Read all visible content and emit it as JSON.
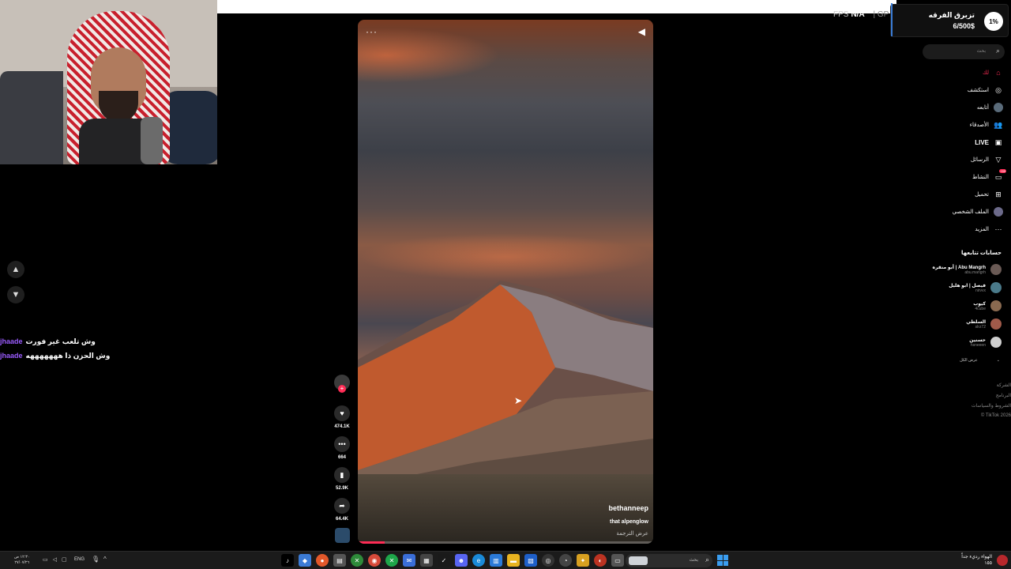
{
  "overlay": {
    "fps_label": "FPS",
    "fps_value": "N/A",
    "gpu_partial": "| GP"
  },
  "goal": {
    "title": "تزبرق الفرقه",
    "amount": "6/500$",
    "percent": "1%"
  },
  "chat": [
    {
      "user": "jhaade",
      "message": "وش تلعب غير فورت"
    },
    {
      "user": "jhaade",
      "message": "وش الحزن ذا هههههههه"
    }
  ],
  "video": {
    "author": "bethanneep",
    "caption": "that alpenglow",
    "translate": "عرض الترجمة",
    "progress": 0.09,
    "menu_icon": "more-icon",
    "volume_icon": "volume-icon"
  },
  "actions": {
    "likes": "474.1K",
    "comments": "664",
    "saves": "52.9K",
    "shares": "64.4K"
  },
  "sidebar": {
    "search_placeholder": "بحث",
    "nav": [
      {
        "label": "لك",
        "icon": "home-icon"
      },
      {
        "label": "استكشف",
        "icon": "compass-icon"
      },
      {
        "label": "أتابعه",
        "icon": "following-avatar-icon"
      },
      {
        "label": "الأصدقاء",
        "icon": "friends-icon"
      },
      {
        "label": "LIVE",
        "icon": "live-icon"
      },
      {
        "label": "الرسائل",
        "icon": "messages-icon"
      },
      {
        "label": "النشاط",
        "icon": "activity-icon",
        "badge": "99+"
      },
      {
        "label": "تحميل",
        "icon": "upload-icon"
      },
      {
        "label": "الملف الشخصي",
        "icon": "profile-icon"
      },
      {
        "label": "المزيد",
        "icon": "more-dots-icon"
      }
    ],
    "following_title": "حسابات تتابعها",
    "accounts": [
      {
        "name": "Abu Mangrh | أبو منقره",
        "handle": "abu.mangrh"
      },
      {
        "name": "فيصل | ابو هليل",
        "handle": "nirvvx"
      },
      {
        "name": "كيوب",
        "handle": "4cube"
      },
      {
        "name": "السلطي",
        "handle": "slrz72"
      },
      {
        "name": "حسنين",
        "handle": "hsneeen"
      }
    ],
    "see_all": "عرض الكل",
    "footer": [
      "الشركة",
      "البرنامج",
      "الشروط والسياسات",
      "© TikTok 2026"
    ]
  },
  "taskbar": {
    "time": "١٢:٣٠ ص",
    "date": "٢٧/٠٧/٢٦",
    "lang": "ENG",
    "search_placeholder": "بحث",
    "news_title": "الهواء رديء جداً",
    "news_sub": "١٥٥"
  }
}
